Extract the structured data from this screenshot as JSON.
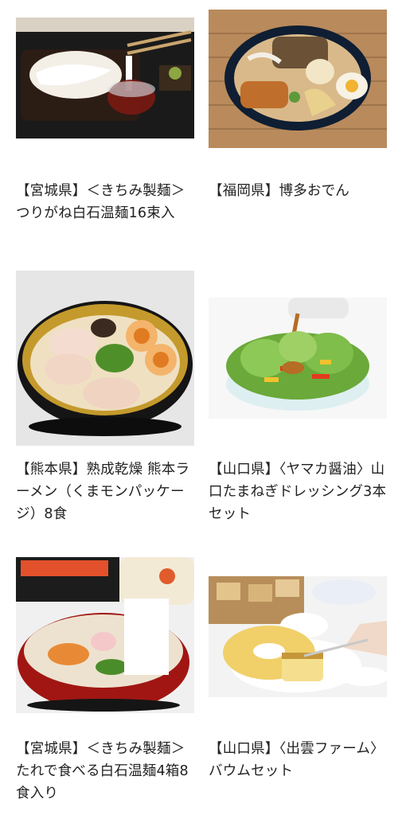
{
  "products": [
    {
      "title": "【宮城県】＜きちみ製麺＞つりがね白石温麺16束入",
      "image": "somen-noodles-on-tray-with-dipping-sauce"
    },
    {
      "title": "【福岡県】博多おでん",
      "image": "oden-in-dark-bowl"
    },
    {
      "title": "【熊本県】熟成乾燥 熊本ラーメン（くまモンパッケージ）8食",
      "image": "tonkotsu-ramen-bowl"
    },
    {
      "title": "【山口県】〈ヤマカ醤油〉山口たまねぎドレッシング3本セット",
      "image": "green-salad-with-dressing"
    },
    {
      "title": "【宮城県】＜きちみ製麺＞たれで食べる白石温麺4箱8食入り",
      "image": "noodle-soup-in-red-bowl"
    },
    {
      "title": "【山口県】〈出雲ファーム〉バウムセット",
      "image": "baumkuchen-cake-on-plate"
    }
  ]
}
